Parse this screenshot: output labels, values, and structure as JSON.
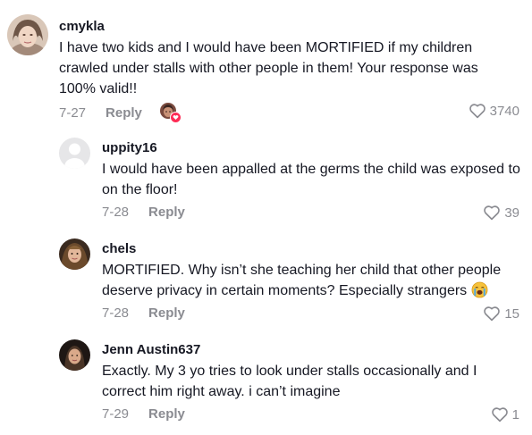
{
  "comments": [
    {
      "username": "cmykla",
      "text": "I have two kids and I would have been MORTIFIED if my children crawled under stalls with other people in them! Your response was 100% valid!!",
      "date": "7-27",
      "reply_label": "Reply",
      "likes": "3740",
      "liked_by_creator": true
    },
    {
      "username": "uppity16",
      "text": "I would have been appalled at the germs the child was exposed to on the floor!",
      "date": "7-28",
      "reply_label": "Reply",
      "likes": "39"
    },
    {
      "username": "chels",
      "text": "MORTIFIED. Why isn’t she teaching her child that other people deserve privacy in certain moments? Especially strangers",
      "emoji": "loudly-crying-face-emoji",
      "date": "7-28",
      "reply_label": "Reply",
      "likes": "15"
    },
    {
      "username": "Jenn Austin637",
      "text": "Exactly. My 3 yo tries to look under stalls occasionally and I correct him right away. i can’t imagine",
      "date": "7-29",
      "reply_label": "Reply",
      "likes": "1"
    }
  ],
  "icons": {
    "like": "heart-outline-icon",
    "creator_like": "creator-heart-badge-icon"
  },
  "colors": {
    "meta_gray": "#8a8b91",
    "badge_red": "#fe2c55",
    "text": "#161823"
  }
}
